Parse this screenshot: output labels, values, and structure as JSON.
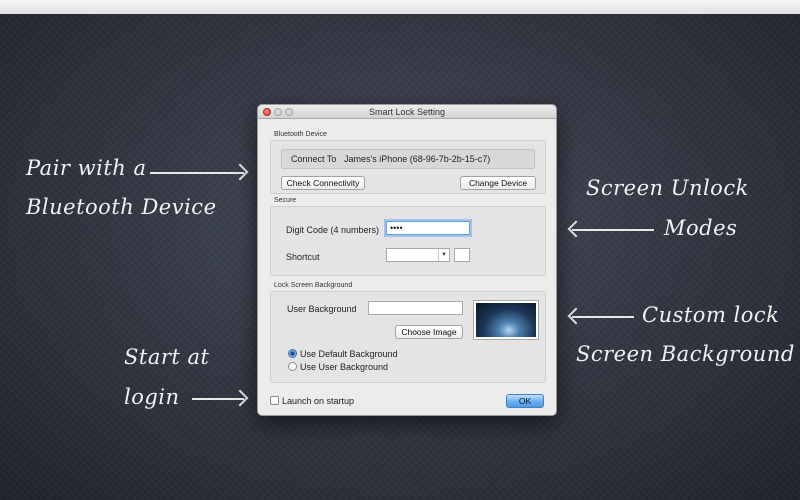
{
  "window": {
    "title": "Smart Lock Setting",
    "bluetooth": {
      "section_label": "Bluetooth Device",
      "connect_label": "Connect To",
      "device_name": "James's iPhone (68-96-7b-2b-15-c7)",
      "check_button": "Check Connectivity",
      "change_button": "Change Device"
    },
    "secure": {
      "section_label": "Secure",
      "digit_code_label": "Digit Code (4 numbers)",
      "digit_code_value": "••••",
      "shortcut_label": "Shortcut",
      "shortcut_value": "",
      "shortcut_key_value": ""
    },
    "background": {
      "section_label": "Lock Screen Background",
      "user_background_label": "User Background",
      "user_background_value": "",
      "choose_button": "Choose Image",
      "options": [
        "Use Default Background",
        "Use User Background"
      ],
      "selected_option": "Use Default Background"
    },
    "launch_label": "Launch on startup",
    "launch_checked": false,
    "ok_button": "OK"
  },
  "annotations": {
    "pair_line1": "Pair with a",
    "pair_line2": "Bluetooth Device",
    "unlock_line1": "Screen Unlock",
    "unlock_line2": "Modes",
    "custom_line1": "Custom lock",
    "custom_line2": "Screen Background",
    "start_line1": "Start at",
    "start_line2": "login"
  },
  "colors": {
    "accent": "#5aa0ea",
    "focus_ring": "#9ec3ee",
    "close_button": "#d7362c"
  }
}
